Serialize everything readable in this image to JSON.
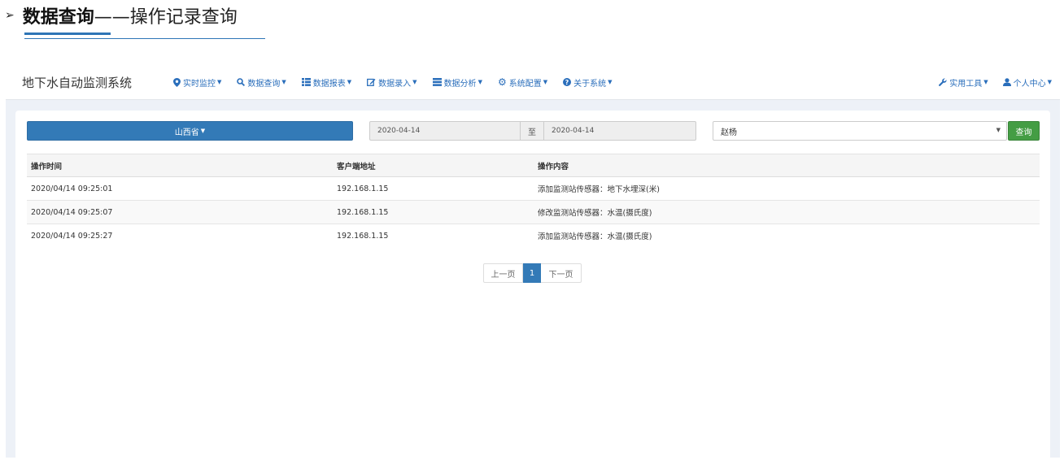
{
  "doc_heading": {
    "arrow": "➢",
    "bold_text": "数据查询",
    "rest_text": "——操作记录查询"
  },
  "app": {
    "brand": "地下水自动监测系统",
    "nav": [
      {
        "label": "实时监控",
        "icon": "map-marker-icon",
        "glyph": "⚲"
      },
      {
        "label": "数据查询",
        "icon": "search-icon",
        "glyph": "⚲"
      },
      {
        "label": "数据报表",
        "icon": "list-icon",
        "glyph": "☰"
      },
      {
        "label": "数据录入",
        "icon": "edit-icon",
        "glyph": "✎"
      },
      {
        "label": "数据分析",
        "icon": "bars-icon",
        "glyph": "≡"
      },
      {
        "label": "系统配置",
        "icon": "gear-icon",
        "glyph": "⚙"
      },
      {
        "label": "关于系统",
        "icon": "question-icon",
        "glyph": "?"
      }
    ],
    "nav_right": [
      {
        "label": "实用工具",
        "icon": "wrench-icon"
      },
      {
        "label": "个人中心",
        "icon": "user-icon"
      }
    ]
  },
  "filters": {
    "province": "山西省",
    "date_start": "2020-04-14",
    "date_separator": "至",
    "date_end": "2020-04-14",
    "user": "赵杨",
    "query_label": "查询"
  },
  "table": {
    "headers": [
      "操作时间",
      "客户端地址",
      "操作内容"
    ],
    "rows": [
      [
        "2020/04/14 09:25:01",
        "192.168.1.15",
        "添加监测站传感器：地下水埋深(米)"
      ],
      [
        "2020/04/14 09:25:07",
        "192.168.1.15",
        "修改监测站传感器：水温(摄氏度)"
      ],
      [
        "2020/04/14 09:25:27",
        "192.168.1.15",
        "添加监测站传感器：水温(摄氏度)"
      ]
    ]
  },
  "pagination": {
    "prev": "上一页",
    "current": "1",
    "next": "下一页"
  },
  "colors": {
    "primary": "#337ab7",
    "success": "#449d44",
    "nav_link": "#2a6ebb",
    "background": "#edf1f7"
  }
}
